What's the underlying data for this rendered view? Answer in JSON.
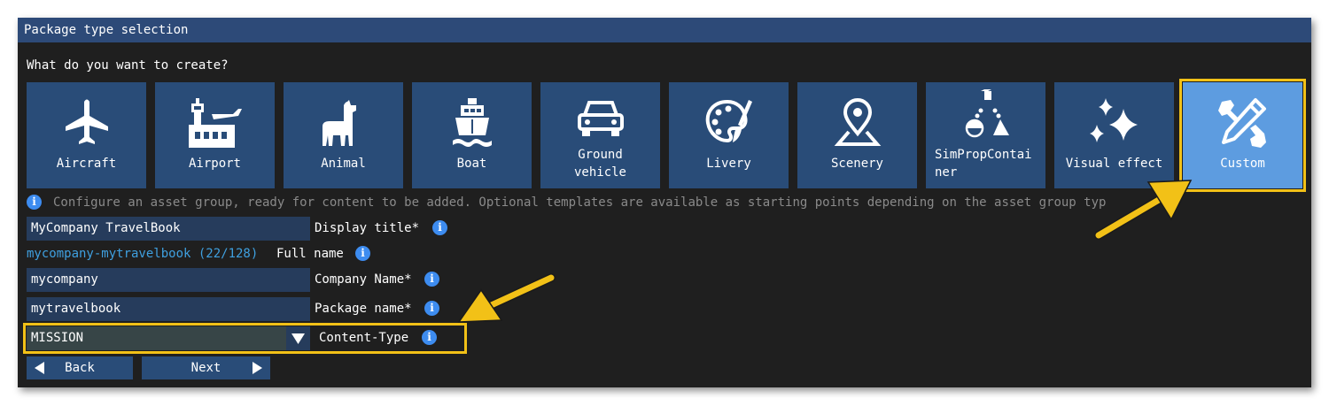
{
  "window": {
    "title": "Package type selection"
  },
  "question": "What do you want to create?",
  "tiles": [
    {
      "label": "Aircraft",
      "icon": "airplane-icon"
    },
    {
      "label": "Airport",
      "icon": "airport-icon"
    },
    {
      "label": "Animal",
      "icon": "llama-icon"
    },
    {
      "label": "Boat",
      "icon": "ship-icon"
    },
    {
      "label_line1": "Ground",
      "label_line2": "vehicle",
      "icon": "car-icon"
    },
    {
      "label": "Livery",
      "icon": "palette-icon"
    },
    {
      "label": "Scenery",
      "icon": "map-pin-icon"
    },
    {
      "label_line1": "SimPropContai",
      "label_line2": "ner",
      "icon": "shapes-icon"
    },
    {
      "label": "Visual effect",
      "icon": "sparkles-icon"
    },
    {
      "label": "Custom",
      "icon": "tools-icon",
      "selected": true
    }
  ],
  "description": "Configure an asset group, ready for content to be added. Optional templates are available as starting points depending on the asset group typ",
  "form": {
    "display_title": {
      "value": "MyCompany TravelBook",
      "label": "Display title*"
    },
    "full_name": {
      "value": "mycompany-mytravelbook (22/128)",
      "label": "Full name"
    },
    "company_name": {
      "value": "mycompany",
      "label": "Company Name*"
    },
    "package_name": {
      "value": "mytravelbook",
      "label": "Package name*"
    },
    "content_type": {
      "value": "MISSION",
      "label": "Content-Type"
    }
  },
  "buttons": {
    "back": "Back",
    "next": "Next"
  },
  "colors": {
    "titlebar": "#2d4a78",
    "tile": "#294c78",
    "tile_selected": "#5d9ce0",
    "highlight": "#f2c117",
    "info": "#3d8cf0",
    "fullname_text": "#3fa0e0"
  }
}
